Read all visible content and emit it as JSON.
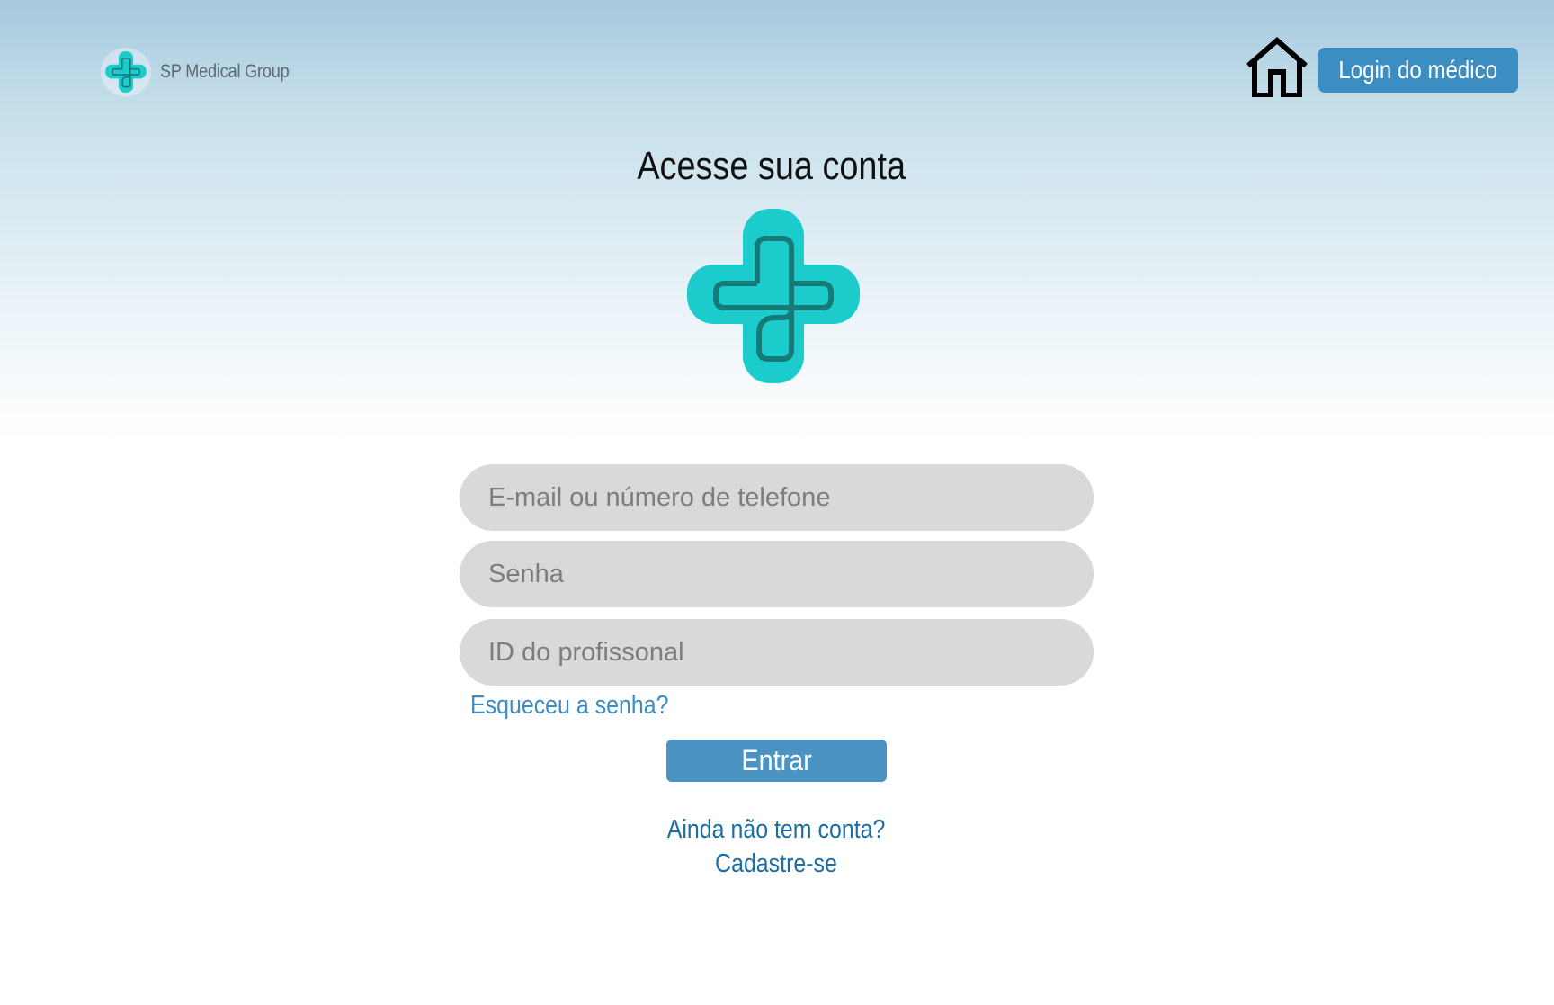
{
  "header": {
    "brand_name": "SP Medical Group",
    "doctor_login_label": "Login do médico"
  },
  "main": {
    "title": "Acesse sua conta"
  },
  "form": {
    "email_placeholder": "E-mail ou número de telefone",
    "email_value": "",
    "password_placeholder": "Senha",
    "password_value": "",
    "professional_id_placeholder": "ID do profissonal",
    "professional_id_value": "",
    "forgot_password_label": "Esqueceu a senha?",
    "submit_label": "Entrar"
  },
  "signup": {
    "line1": "Ainda não tem conta?",
    "line2": "Cadastre-se"
  },
  "icons": {
    "brand_logo": "medical-cross-icon",
    "home": "home-icon",
    "hero_logo": "medical-cross-icon"
  },
  "colors": {
    "accent": "#3b8dc2",
    "logo_cyan": "#1ccbcb",
    "logo_dark": "#157a78",
    "input_bg": "#d9d9d9",
    "link_dark": "#1c6fa5"
  }
}
